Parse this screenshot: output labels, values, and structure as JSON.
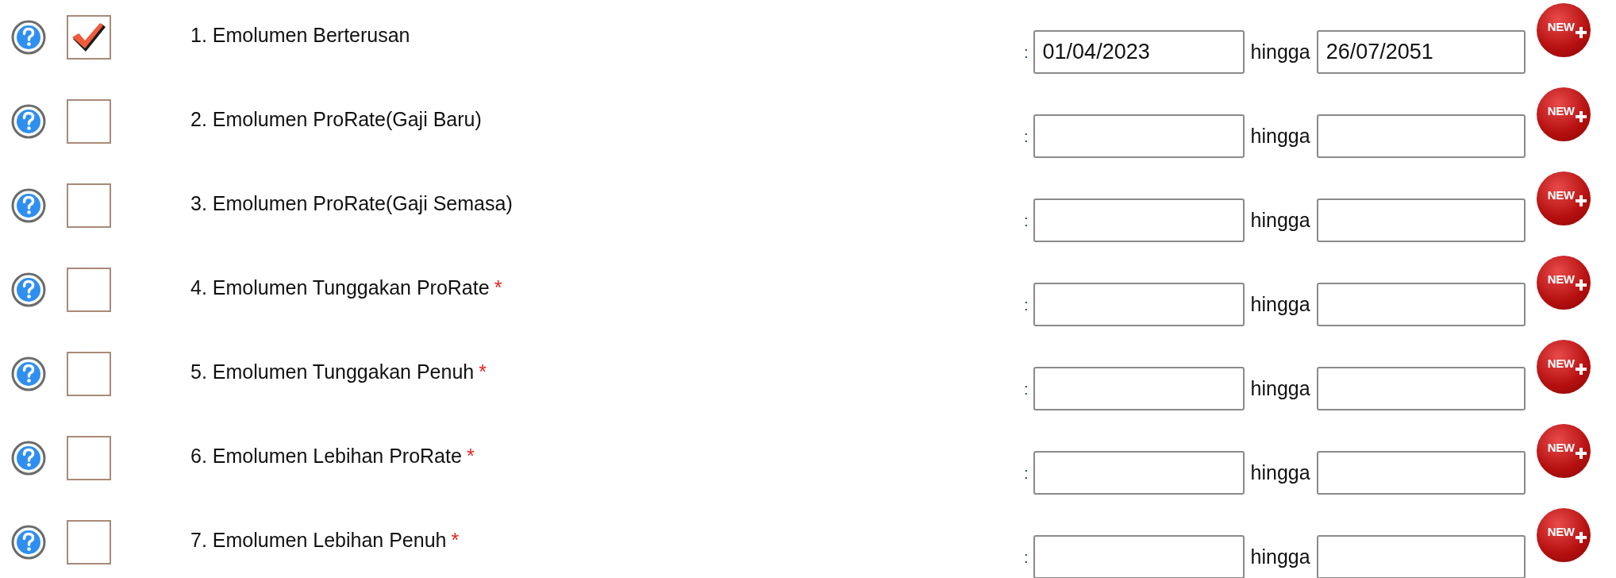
{
  "rows": [
    {
      "checked": true,
      "label": "1. Emolumen Berterusan",
      "required": false,
      "colon": ":",
      "from": "01/04/2023",
      "connector": "hingga",
      "to": "26/07/2051",
      "badge": "NEW"
    },
    {
      "checked": false,
      "label": "2. Emolumen ProRate(Gaji Baru)",
      "required": false,
      "colon": ":",
      "connector": "hingga",
      "badge": "NEW"
    },
    {
      "checked": false,
      "label": "3. Emolumen ProRate(Gaji Semasa)",
      "required": false,
      "colon": ":",
      "connector": "hingga",
      "badge": "NEW"
    },
    {
      "checked": false,
      "label": "4. Emolumen Tunggakan ProRate",
      "required": true,
      "colon": ":",
      "connector": "hingga",
      "badge": "NEW"
    },
    {
      "checked": false,
      "label": "5. Emolumen Tunggakan Penuh",
      "required": true,
      "colon": ":",
      "connector": "hingga",
      "badge": "NEW"
    },
    {
      "checked": false,
      "label": "6. Emolumen Lebihan ProRate",
      "required": true,
      "colon": ":",
      "connector": "hingga",
      "badge": "NEW"
    },
    {
      "checked": false,
      "label": "7. Emolumen Lebihan Penuh",
      "required": true,
      "colon": ":",
      "connector": "hingga",
      "badge": "NEW"
    }
  ],
  "required_mark": "*"
}
